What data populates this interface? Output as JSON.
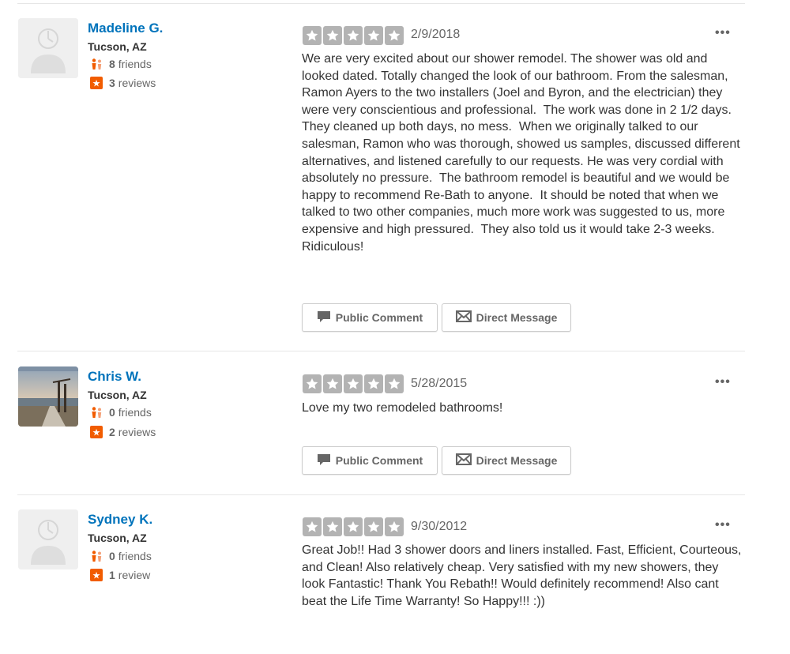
{
  "colors": {
    "link": "#0073bb",
    "star": "#b3b3b3",
    "review_accent": "#f15c00"
  },
  "reviews": [
    {
      "user": {
        "name": "Madeline G.",
        "location": "Tucson, AZ",
        "friends_count": "8",
        "friends_label": "friends",
        "reviews_count": "3",
        "reviews_label": "reviews",
        "avatar": "default-avatar"
      },
      "rating": 5,
      "date": "2/9/2018",
      "text": "We are very excited about our shower remodel. The shower was old and looked dated. Totally changed the look of our bathroom. From the salesman, Ramon Ayers to the two installers (Joel and Byron, and the electrician) they were very conscientious and professional.  The work was done in 2 1/2 days.  They cleaned up both days, no mess.  When we originally talked to our salesman, Ramon who was thorough, showed us samples, discussed different alternatives, and listened carefully to our requests. He was very cordial with absolutely no pressure.  The bathroom remodel is beautiful and we would be happy to recommend Re-Bath to anyone.  It should be noted that when we talked to two other companies, much more work was suggested to us, more expensive and high pressured.  They also told us it would take 2-3 weeks.  Ridiculous!",
      "buttons": {
        "public_comment": "Public Comment",
        "direct_message": "Direct Message"
      }
    },
    {
      "user": {
        "name": "Chris W.",
        "location": "Tucson, AZ",
        "friends_count": "0",
        "friends_label": "friends",
        "reviews_count": "2",
        "reviews_label": "reviews",
        "avatar": "photo-avatar"
      },
      "rating": 5,
      "date": "5/28/2015",
      "text": "Love my two remodeled bathrooms!",
      "buttons": {
        "public_comment": "Public Comment",
        "direct_message": "Direct Message"
      }
    },
    {
      "user": {
        "name": "Sydney K.",
        "location": "Tucson, AZ",
        "friends_count": "0",
        "friends_label": "friends",
        "reviews_count": "1",
        "reviews_label": "review",
        "avatar": "default-avatar"
      },
      "rating": 5,
      "date": "9/30/2012",
      "text": "Great Job!! Had 3 shower doors and liners installed. Fast, Efficient, Courteous, and Clean! Also relatively cheap. Very satisfied with my new showers, they look Fantastic! Thank You Rebath!! Would definitely recommend! Also cant beat the Life Time Warranty! So Happy!!! :))"
    }
  ],
  "more_icon": "ellipsis-icon"
}
